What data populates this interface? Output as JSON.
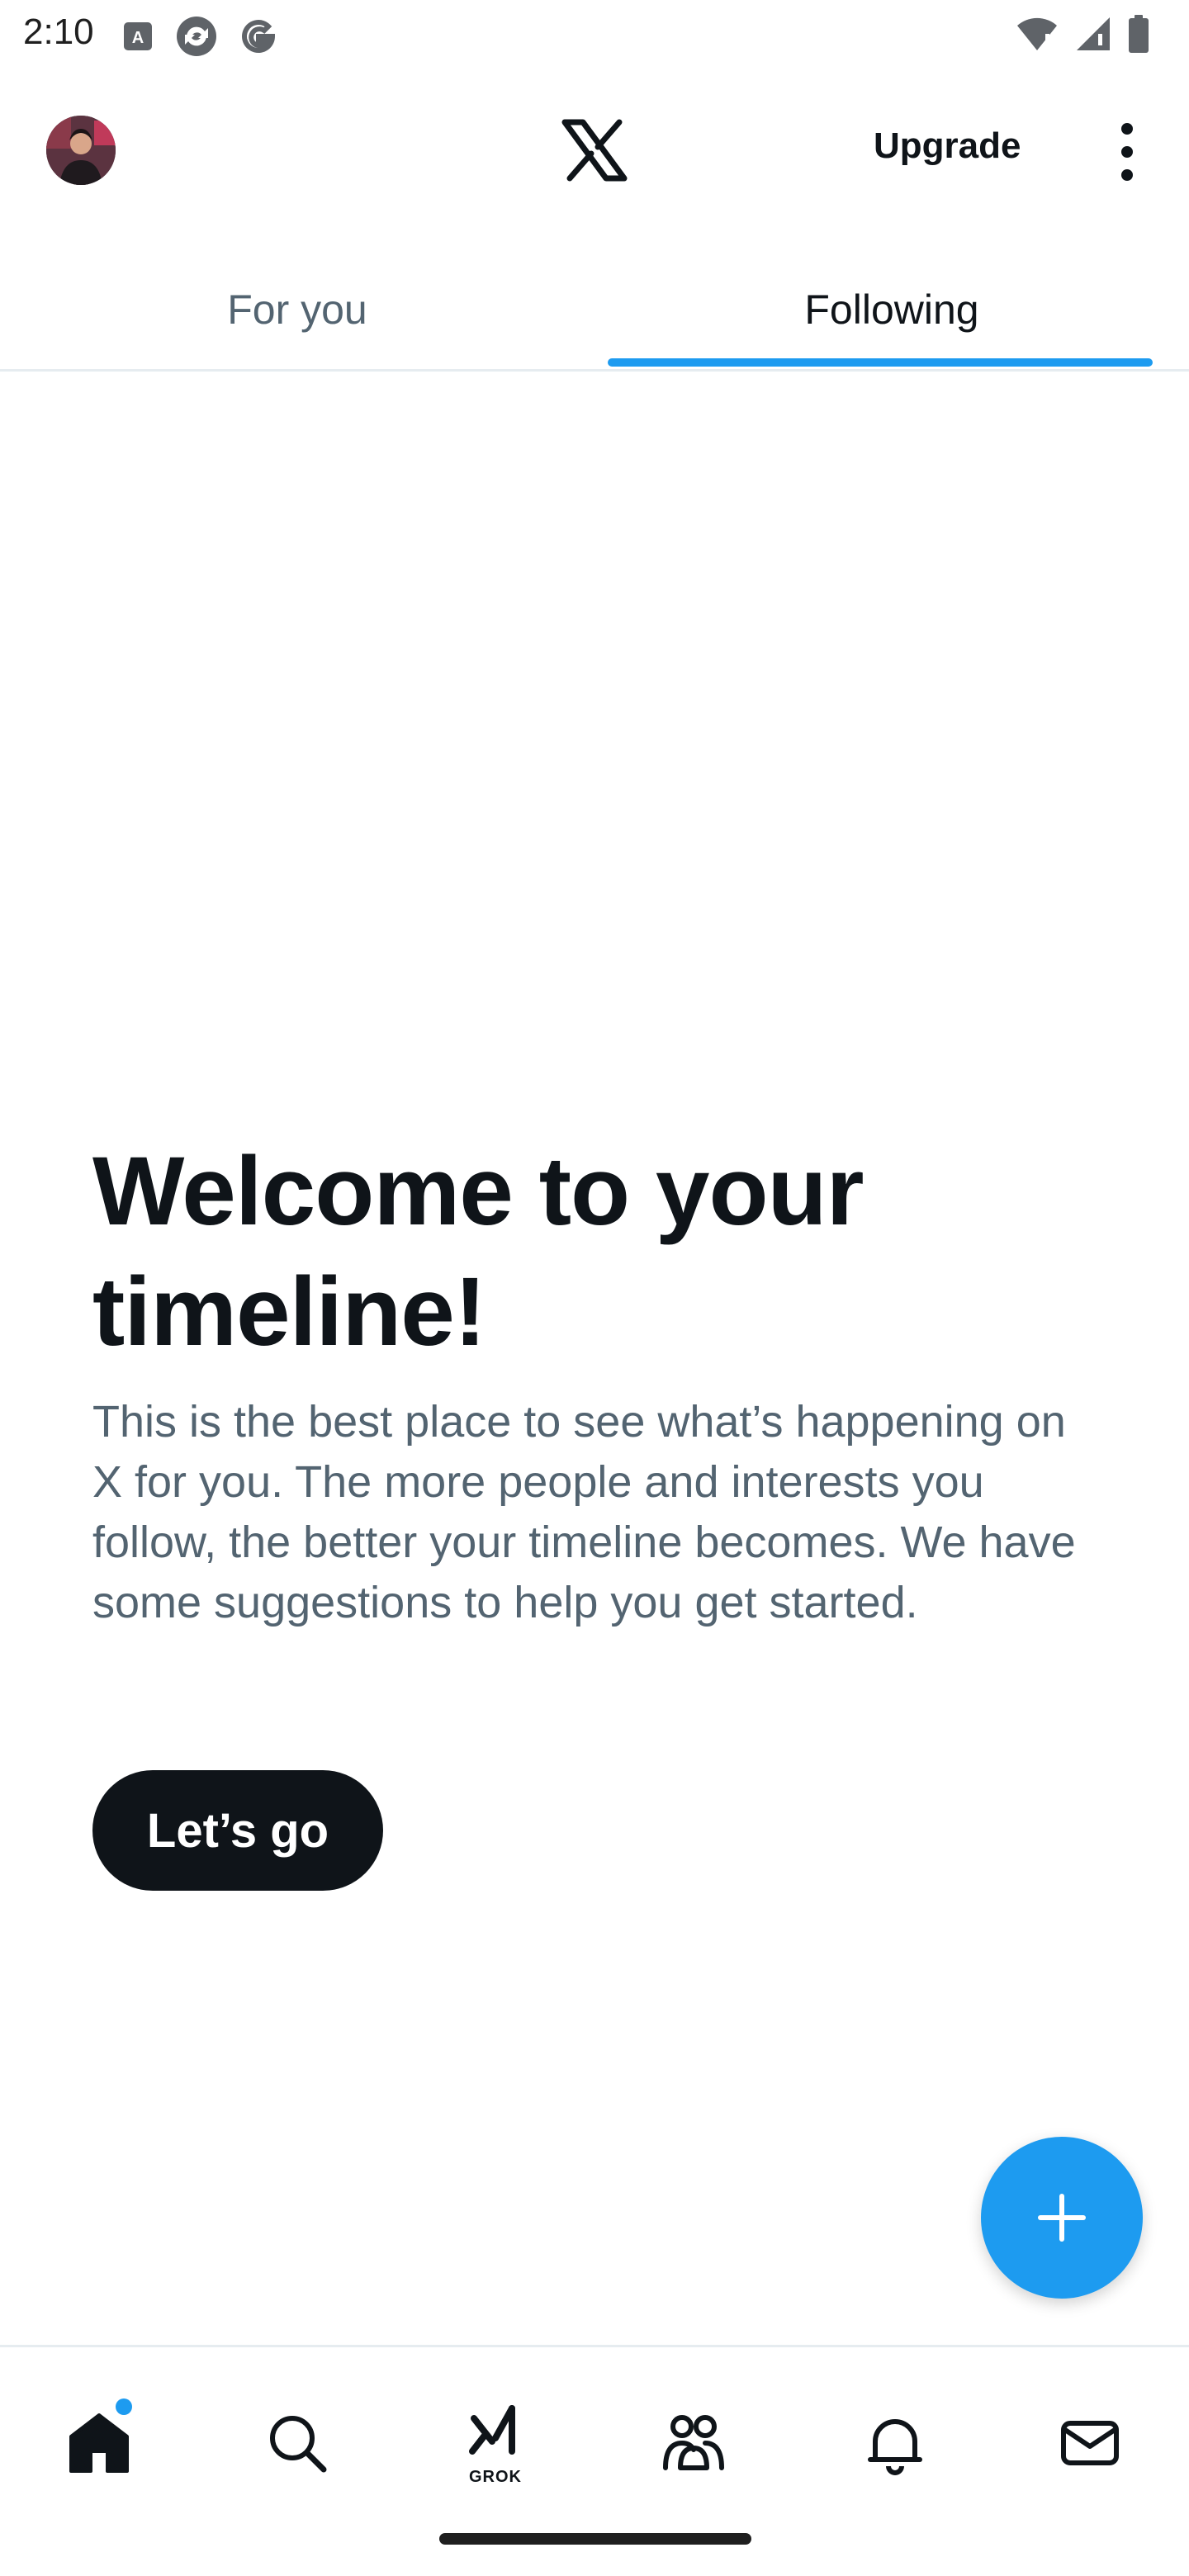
{
  "status_bar": {
    "time": "2:10",
    "left_icons": [
      "accessibility-icon",
      "sync-icon",
      "google-icon"
    ],
    "right_icons": [
      "wifi-icon",
      "signal-icon",
      "battery-icon"
    ]
  },
  "header": {
    "avatar": "avatar",
    "logo": "x-logo-icon",
    "upgrade_label": "Upgrade",
    "more_icon": "more-vertical-icon"
  },
  "tabs": {
    "items": [
      {
        "label": "For you",
        "selected": false
      },
      {
        "label": "Following",
        "selected": true
      }
    ]
  },
  "main": {
    "title": "Welcome to your timeline!",
    "body": "This is the best place to see what’s happening on X for you. The more people and interests you follow, the better your timeline becomes. We have some suggestions to help you get started.",
    "cta_label": "Let’s go"
  },
  "fab": {
    "icon": "plus-icon"
  },
  "bottom_nav": {
    "items": [
      {
        "icon": "home-icon",
        "active": true,
        "badge": true
      },
      {
        "icon": "search-icon",
        "active": false
      },
      {
        "icon": "grok-icon",
        "label": "GROK",
        "active": false
      },
      {
        "icon": "communities-icon",
        "active": false
      },
      {
        "icon": "bell-icon",
        "active": false
      },
      {
        "icon": "mail-icon",
        "active": false
      }
    ]
  },
  "colors": {
    "accent": "#1d9bf0",
    "text_primary": "#0f1419",
    "text_secondary": "#536471",
    "divider": "#e6ecf0"
  }
}
